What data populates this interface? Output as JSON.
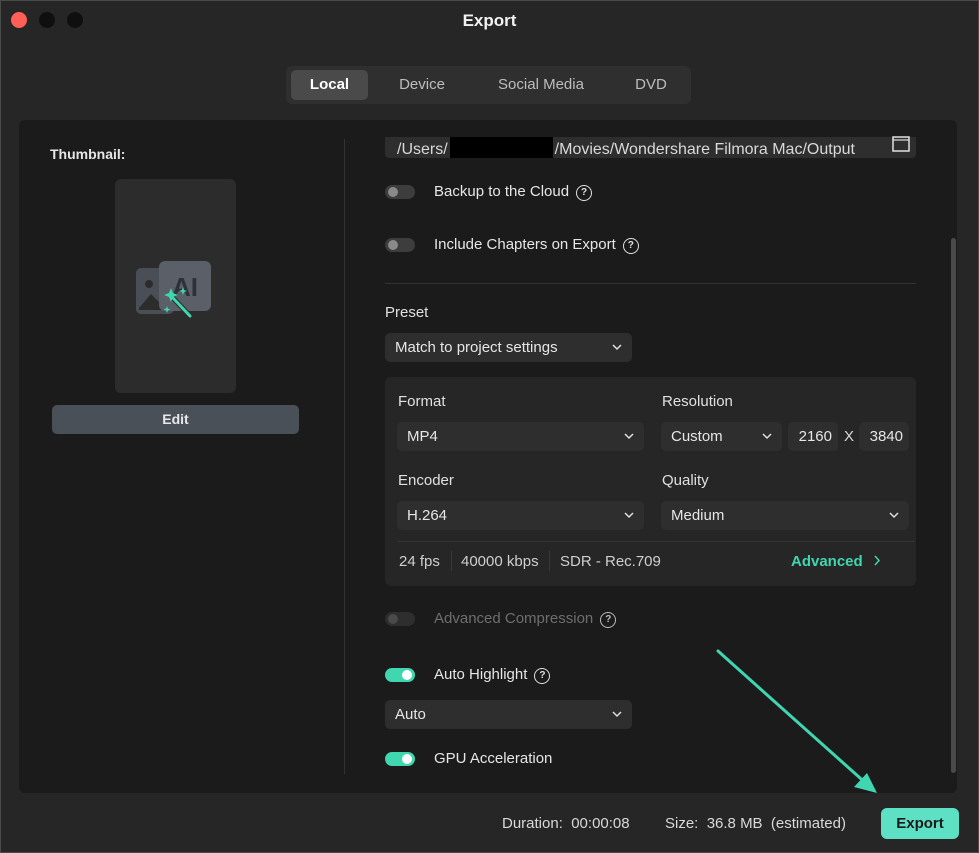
{
  "window": {
    "title": "Export"
  },
  "tabs": [
    {
      "label": "Local",
      "active": true
    },
    {
      "label": "Device",
      "active": false
    },
    {
      "label": "Social Media",
      "active": false
    },
    {
      "label": "DVD",
      "active": false
    }
  ],
  "thumbnail": {
    "label": "Thumbnail:",
    "edit_label": "Edit",
    "icon_text": "AI"
  },
  "output": {
    "path_prefix": "/Users/",
    "path_suffix": "/Movies/Wondershare Filmora Mac/Output"
  },
  "options": {
    "backup_cloud": {
      "label": "Backup to the Cloud",
      "on": false
    },
    "include_chapters": {
      "label": "Include Chapters on Export",
      "on": false
    },
    "advanced_compression": {
      "label": "Advanced Compression",
      "on": false,
      "disabled": true
    },
    "auto_highlight": {
      "label": "Auto Highlight",
      "on": true,
      "value": "Auto"
    },
    "gpu_acceleration": {
      "label": "GPU Acceleration",
      "on": true
    }
  },
  "preset": {
    "label": "Preset",
    "value": "Match to project settings"
  },
  "settings": {
    "format_label": "Format",
    "format_value": "MP4",
    "resolution_label": "Resolution",
    "resolution_value": "Custom",
    "width": "2160",
    "separator": "X",
    "height": "3840",
    "encoder_label": "Encoder",
    "encoder_value": "H.264",
    "quality_label": "Quality",
    "quality_value": "Medium",
    "fps": "24 fps",
    "bitrate": "40000 kbps",
    "color": "SDR - Rec.709",
    "advanced_label": "Advanced"
  },
  "footer": {
    "duration_label": "Duration:",
    "duration_value": "00:00:08",
    "size_label": "Size:",
    "size_value": "36.8 MB",
    "size_note": "(estimated)",
    "export_label": "Export"
  },
  "help_glyph": "?",
  "colors": {
    "accent": "#3fd6b0",
    "export_button": "#5ee0c4",
    "arrow": "#3fd6b0"
  }
}
